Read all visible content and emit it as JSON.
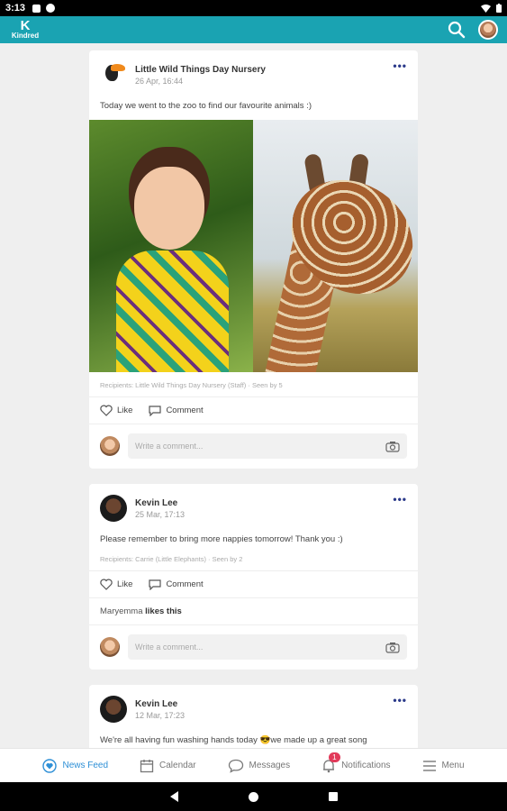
{
  "status_bar": {
    "time": "3:13"
  },
  "app_bar": {
    "logo_letter": "K",
    "logo_name": "Kindred",
    "search_icon": "search-icon",
    "avatar_icon": "user-avatar"
  },
  "posts": [
    {
      "author": "Little Wild Things Day Nursery",
      "date": "26 Apr, 16:44",
      "text": "Today we went to the zoo to find our favourite animals :)",
      "recipients": "Recipients: Little Wild Things Day Nursery (Staff) · Seen by 5",
      "like_label": "Like",
      "comment_label": "Comment",
      "comment_placeholder": "Write a comment..."
    },
    {
      "author": "Kevin Lee",
      "date": "25 Mar, 17:13",
      "text": "Please remember to bring more nappies tomorrow! Thank you :)",
      "recipients": "Recipients: Carrie (Little Elephants) · Seen by 2",
      "like_label": "Like",
      "comment_label": "Comment",
      "likes_user": "Maryemma",
      "likes_suffix": "likes this",
      "comment_placeholder": "Write a comment..."
    },
    {
      "author": "Kevin Lee",
      "date": "12 Mar, 17:23",
      "text": "We're all having fun washing hands today 😎we made up a great song"
    }
  ],
  "bottom_nav": {
    "items": [
      {
        "label": "News Feed",
        "icon": "heart-circle-icon",
        "active": true
      },
      {
        "label": "Calendar",
        "icon": "calendar-icon"
      },
      {
        "label": "Messages",
        "icon": "chat-icon"
      },
      {
        "label": "Notifications",
        "icon": "bell-icon",
        "badge": "1"
      },
      {
        "label": "Menu",
        "icon": "menu-icon"
      }
    ]
  },
  "colors": {
    "brand": "#1aa3b2",
    "active_nav": "#2d8fd6",
    "badge": "#e23a5a",
    "more_dots": "#2b3a8a"
  }
}
